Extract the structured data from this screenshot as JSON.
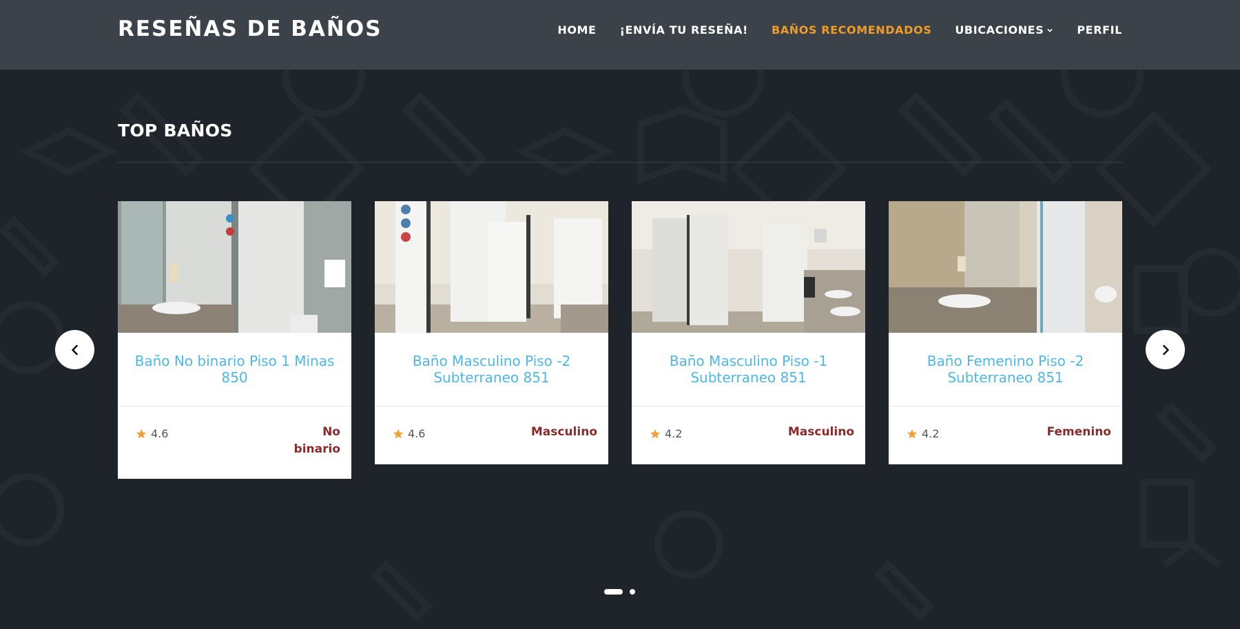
{
  "header": {
    "brand": "RESEÑAS DE BAÑOS",
    "nav": [
      {
        "label": "HOME",
        "active": false
      },
      {
        "label": "¡ENVÍA TU RESEÑA!",
        "active": false
      },
      {
        "label": "BAÑOS RECOMENDADOS",
        "active": true
      },
      {
        "label": "UBICACIONES",
        "active": false,
        "dropdown": true
      },
      {
        "label": "PERFIL",
        "active": false
      }
    ]
  },
  "section": {
    "title": "TOP BAÑOS"
  },
  "cards": [
    {
      "title": "Baño No binario Piso 1 Minas 850",
      "rating": "4.6",
      "gender_line1": "No",
      "gender_line2": "binario"
    },
    {
      "title": "Baño Masculino Piso -2 Subterraneo 851",
      "rating": "4.6",
      "gender_line1": "Masculino",
      "gender_line2": ""
    },
    {
      "title": "Baño Masculino Piso -1 Subterraneo 851",
      "rating": "4.2",
      "gender_line1": "Masculino",
      "gender_line2": ""
    },
    {
      "title": "Baño Femenino Piso -2 Subterraneo 851",
      "rating": "4.2",
      "gender_line1": "Femenino",
      "gender_line2": ""
    }
  ],
  "colors": {
    "accent": "#f39c23",
    "title_blue": "#4fb7e3",
    "gender_red": "#8a2a2a",
    "header_bg": "#3c4249",
    "page_bg": "#1f232a"
  },
  "icons": {
    "prev": "chevron-left-icon",
    "next": "chevron-right-icon",
    "star": "star-icon",
    "dropdown": "chevron-down-icon"
  },
  "carousel": {
    "pages": 2,
    "current": 1
  }
}
